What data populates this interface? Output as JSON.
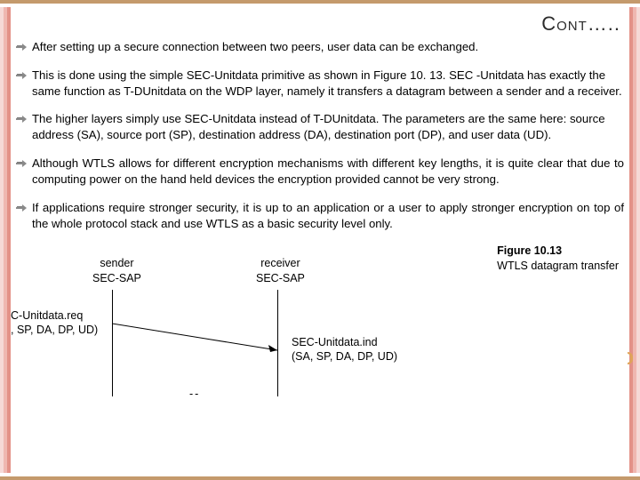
{
  "title": "Cont…..",
  "bullets": [
    "After setting up a secure connection between two peers, user data can be exchanged.",
    "This is done using the simple SEC-Unitdata primitive as shown in Figure 10. 13. SEC -Unitdata has exactly the same function as T-DUnitdata on the WDP layer, namely it transfers a datagram between a sender and a receiver.",
    "The higher layers simply use SEC-Unitdata instead of T-DUnitdata. The parameters are the same here: source address (SA), source port (SP), destination address (DA), destination port (DP), and user data (UD).",
    "Although WTLS allows for different encryption mechanisms with different key lengths, it is quite clear that due to computing power on the hand held devices the encryption provided cannot be very strong.",
    "If applications require stronger security, it is up to an application or a user to apply stronger encryption on top of the whole protocol stack and use WTLS as a basic security level only."
  ],
  "figure": {
    "caption_title": "Figure 10.13",
    "caption_sub": "WTLS datagram transfer",
    "sender_head1": "sender",
    "sender_head2": "SEC-SAP",
    "receiver_head1": "receiver",
    "receiver_head2": "SEC-SAP",
    "req_line1": "C-Unitdata.req",
    "req_line2": ", SP, DA, DP, UD)",
    "ind_line1": "SEC-Unitdata.ind",
    "ind_line2": "(SA, SP, DA, DP, UD)",
    "dash": "--"
  }
}
